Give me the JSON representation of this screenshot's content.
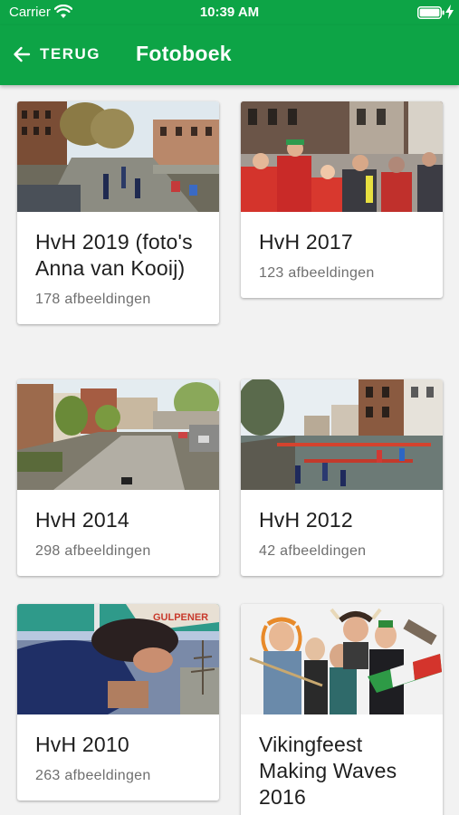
{
  "status_bar": {
    "carrier": "Carrier",
    "time": "10:39 AM"
  },
  "nav": {
    "back_label": "TERUG",
    "title": "Fotoboek"
  },
  "colors": {
    "brand_green": "#0da446",
    "card_bg": "#ffffff",
    "page_bg": "#f2f2f2",
    "count_text": "#6f6f6f"
  },
  "albums": [
    {
      "title": "HvH 2019 (foto's Anna van Kooij)",
      "count": "178 afbeeldingen"
    },
    {
      "title": "HvH 2017",
      "count": "123 afbeeldingen"
    },
    {
      "title": "HvH 2014",
      "count": "298 afbeeldingen"
    },
    {
      "title": "HvH 2012",
      "count": "42 afbeeldingen"
    },
    {
      "title": "HvH 2010",
      "count": "263 afbeeldingen"
    },
    {
      "title": "Vikingfeest Making Waves 2016",
      "count": ""
    }
  ]
}
